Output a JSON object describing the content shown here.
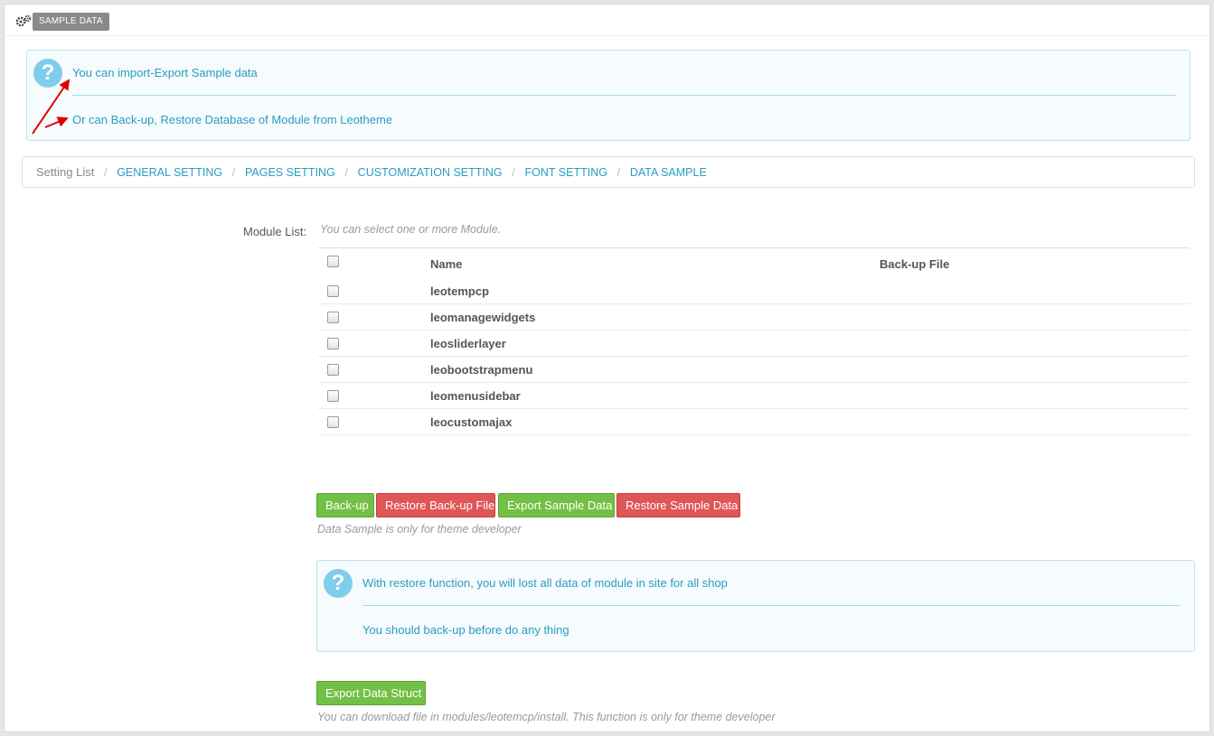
{
  "panel": {
    "title": "SAMPLE DATA",
    "icon": "gears-icon"
  },
  "info_alert": {
    "line1": "You can import-Export Sample data",
    "line2": "Or can Back-up, Restore Database of Module from Leotheme",
    "arrow_color": "#e00000"
  },
  "breadcrumb": {
    "root": "Setting List",
    "items": [
      "GENERAL SETTING",
      "PAGES SETTING",
      "CUSTOMIZATION SETTING",
      "FONT SETTING",
      "DATA SAMPLE"
    ]
  },
  "modules": {
    "label": "Module List:",
    "hint": "You can select one or more Module.",
    "columns": [
      "Name",
      "Back-up File"
    ],
    "rows": [
      "leotempcp",
      "leomanagewidgets",
      "leosliderlayer",
      "leobootstrapmenu",
      "leomenusidebar",
      "leocustomajax"
    ]
  },
  "actions": {
    "backup": "Back-up",
    "restore_backup": "Restore Back-up File",
    "export_sample": "Export Sample Data",
    "restore_sample": "Restore Sample Data",
    "note": "Data Sample is only for theme developer"
  },
  "warning_alert": {
    "line1": "With restore function, you will lost all data of module in site for all shop",
    "line2": "You should back-up before do any thing"
  },
  "export_struct": {
    "button": "Export Data Struct",
    "note": "You can download file in modules/leotemcp/install. This function is only for theme developer"
  },
  "colors": {
    "link": "#2a9cc4",
    "green": "#72c045",
    "red": "#e05656"
  }
}
